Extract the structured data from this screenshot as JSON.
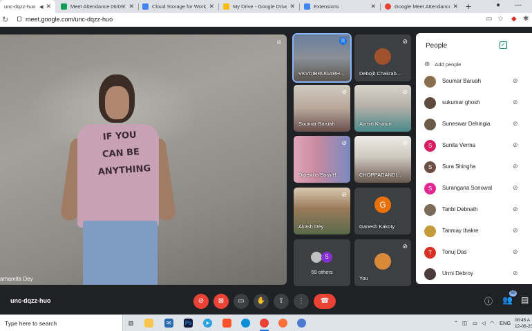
{
  "browser": {
    "tabs": [
      {
        "title": "unc-dqzz-huo",
        "color": "#ffffff",
        "active": true
      },
      {
        "title": "Meet Attendance 06/09/20...",
        "color": "#0f9d58"
      },
      {
        "title": "Cloud Storage for Work and",
        "color": "#4285f4"
      },
      {
        "title": "My Drive - Google Drive",
        "color": "#fbbc04"
      },
      {
        "title": "Extensions",
        "color": "#4285f4"
      },
      {
        "title": "Google Meet Attendance T...",
        "color": "#ea4335"
      }
    ],
    "new_tab_icon": "+",
    "url": "meet.google.com/unc-dqzz-huo"
  },
  "main_video": {
    "name": "arnamita Dey",
    "shirt_text": [
      "IF YOU",
      "CAN BE",
      "ANYTHING"
    ]
  },
  "tiles": [
    {
      "name": "VKVDIBRUGARH...",
      "speaking": true
    },
    {
      "name": "Debojit Chakrab..."
    },
    {
      "name": "Soumar Baruah"
    },
    {
      "name": "Azmin Khatun"
    },
    {
      "name": "Dipeikha Bora H..."
    },
    {
      "name": "CHOPPADANDI..."
    },
    {
      "name": "Akash Dey"
    },
    {
      "name": "Ganesh Kakoty",
      "initial": "G",
      "color": "#e8710a"
    },
    {
      "name": "59 others",
      "initial": "S",
      "color": "#8430ce"
    },
    {
      "name": "You"
    }
  ],
  "people_panel": {
    "title": "People",
    "add_people": "Add people",
    "participants": [
      {
        "name": "Soumar Baruah",
        "color": "#8a6d4d"
      },
      {
        "name": "sukumar ghosh",
        "color": "#5d4a3c"
      },
      {
        "name": "Suneswar Dehingia",
        "color": "#6b5a4a"
      },
      {
        "name": "Sunita Verma",
        "initial": "S",
        "color": "#d81b60"
      },
      {
        "name": "Sura Shingha",
        "initial": "S",
        "color": "#6d4c41"
      },
      {
        "name": "Surangana Sonowal",
        "initial": "S",
        "color": "#e52592"
      },
      {
        "name": "Tanbi Debnath",
        "color": "#7a6a58"
      },
      {
        "name": "Tanmay thakre",
        "color": "#c49a3a"
      },
      {
        "name": "Tonuj Das",
        "initial": "T",
        "color": "#d93025"
      },
      {
        "name": "Urmi Debroy",
        "color": "#4a3a3a"
      }
    ]
  },
  "controls": {
    "meeting_code": "unc-dqzz-huo",
    "participant_count": "69",
    "colors": {
      "muted": "#ea4335",
      "end_call": "#ea4335"
    }
  },
  "taskbar": {
    "search_placeholder": "Type here to search",
    "language": "ENG",
    "time": "08:45 A",
    "date": "12-06-20"
  }
}
